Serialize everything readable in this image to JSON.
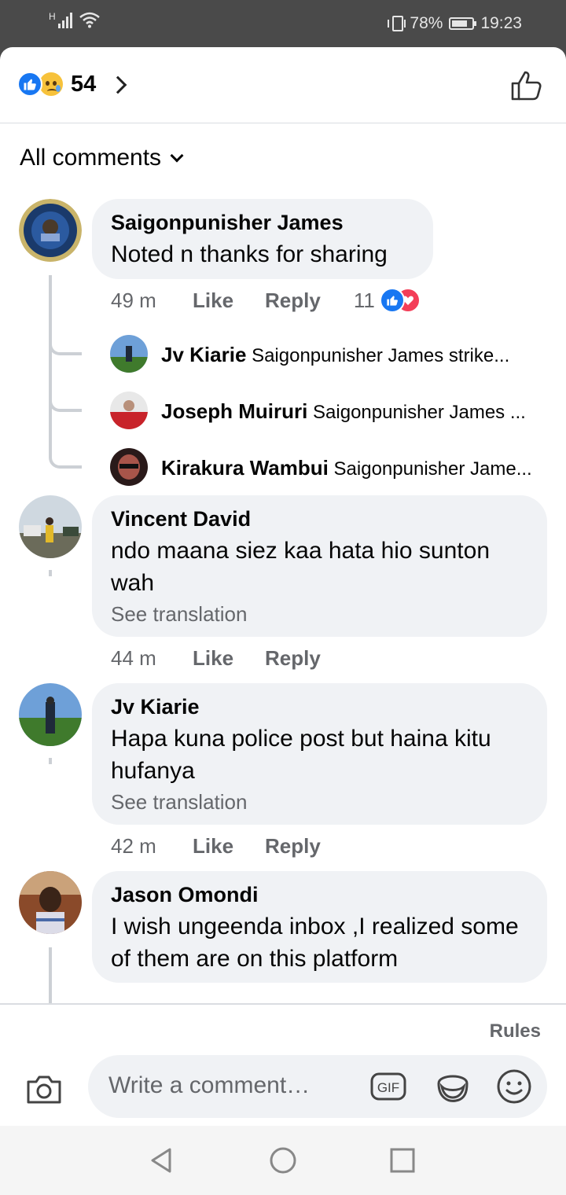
{
  "status_bar": {
    "network": "H",
    "battery": "78%",
    "time": "19:23"
  },
  "header": {
    "reaction_count": "54"
  },
  "filter": {
    "label": "All comments"
  },
  "comments": [
    {
      "name": "Saigonpunisher James",
      "text": "Noted n thanks for sharing",
      "time": "49 m",
      "like": "Like",
      "reply": "Reply",
      "reactions": "11",
      "replies": [
        {
          "name": "Jv Kiarie",
          "text": "Saigonpunisher James  strike..."
        },
        {
          "name": "Joseph Muiruri",
          "text": "Saigonpunisher James  ..."
        },
        {
          "name": "Kirakura Wambui",
          "text": "Saigonpunisher Jame..."
        }
      ]
    },
    {
      "name": "Vincent David",
      "text": " ndo maana siez kaa hata hio sunton wah",
      "translation": "See translation",
      "time": "44 m",
      "like": "Like",
      "reply": "Reply"
    },
    {
      "name": "Jv Kiarie",
      "text": "Hapa kuna police post but haina kitu hufanya",
      "translation": "See translation",
      "time": "42 m",
      "like": "Like",
      "reply": "Reply"
    },
    {
      "name": "Jason Omondi",
      "text": "I wish ungeenda inbox ,I realized some of them are on this platform"
    }
  ],
  "composer": {
    "rules": "Rules",
    "placeholder": "Write a comment…",
    "gif": "GIF"
  },
  "colors": {
    "accent": "#1877f2",
    "love": "#f33e58",
    "bubble": "#f0f2f5",
    "secondary_text": "#65676b"
  }
}
